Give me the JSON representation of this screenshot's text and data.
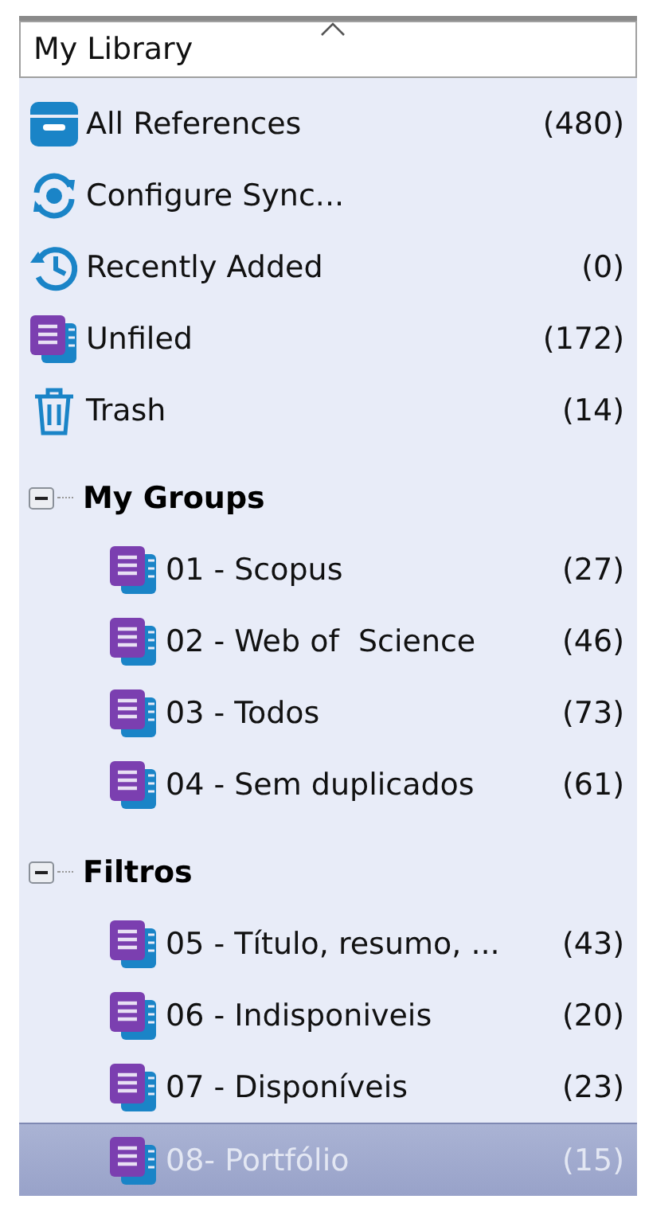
{
  "library": {
    "title": "My Library"
  },
  "items": [
    {
      "kind": "all",
      "label": "All References",
      "count": "(480)"
    },
    {
      "kind": "sync",
      "label": "Configure Sync..."
    },
    {
      "kind": "recent",
      "label": "Recently Added",
      "count": "(0)"
    },
    {
      "kind": "unfiled",
      "label": "Unfiled",
      "count": "(172)"
    },
    {
      "kind": "trash",
      "label": "Trash",
      "count": "(14)"
    }
  ],
  "groups": [
    {
      "name": "My Groups",
      "expanded": true,
      "children": [
        {
          "label": "01 - Scopus",
          "count": "(27)",
          "selected": false
        },
        {
          "label": "02 - Web of  Science",
          "count": "(46)",
          "selected": false
        },
        {
          "label": "03 - Todos",
          "count": "(73)",
          "selected": false
        },
        {
          "label": "04 - Sem duplicados",
          "count": "(61)",
          "selected": false
        }
      ]
    },
    {
      "name": "Filtros",
      "expanded": true,
      "children": [
        {
          "label": "05 - Título, resumo, ...",
          "count": "(43)",
          "selected": false
        },
        {
          "label": "06 - Indisponiveis",
          "count": "(20)",
          "selected": false
        },
        {
          "label": "07 - Disponíveis",
          "count": "(23)",
          "selected": false
        },
        {
          "label": "08- Portfólio",
          "count": "(15)",
          "selected": true
        }
      ]
    }
  ]
}
